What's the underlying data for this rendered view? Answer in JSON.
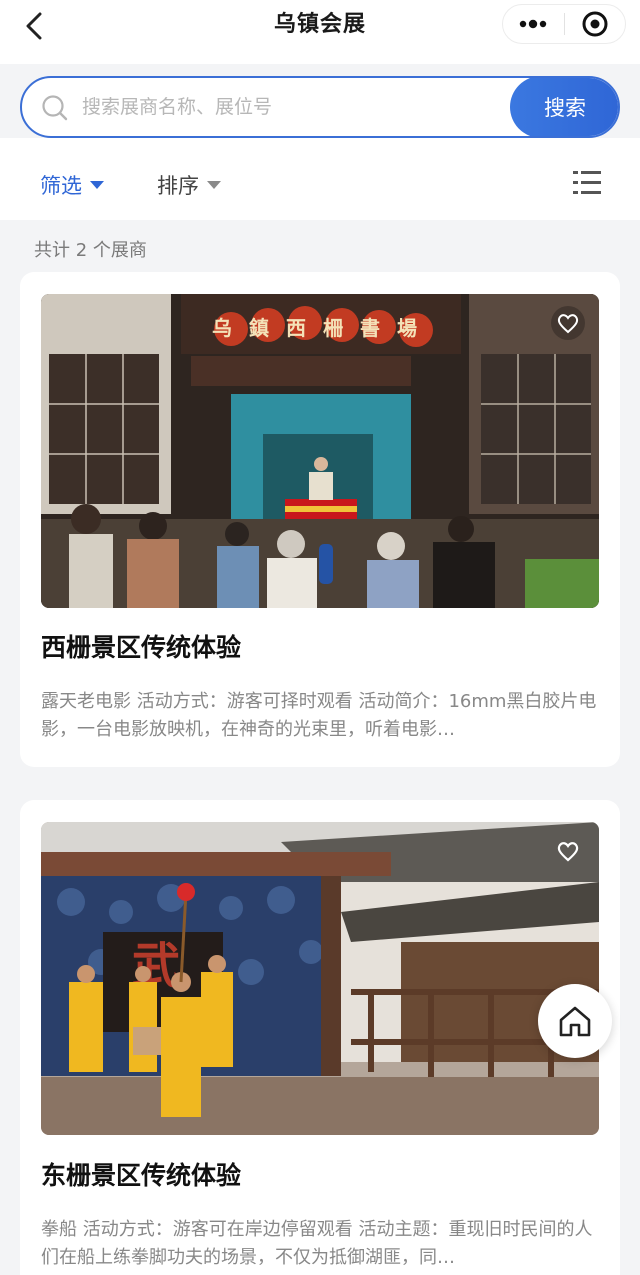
{
  "header": {
    "title": "乌镇会展",
    "back_icon": "chevron-left-icon",
    "more_icon": "more-dots-icon",
    "close_icon": "target-close-icon"
  },
  "search": {
    "placeholder": "搜索展商名称、展位号",
    "value": "",
    "button_label": "搜索"
  },
  "toolbar": {
    "filter_label": "筛选",
    "sort_label": "排序",
    "view_toggle_icon": "list-view-icon",
    "accent_color": "#2f66d6"
  },
  "results": {
    "count_text": "共计 2 个展商"
  },
  "items": [
    {
      "title": "西栅景区传统体验",
      "description": "露天老电影 活动方式：游客可择时观看 活动简介：16mm黑白胶片电影，一台电影放映机，在神奇的光束里，听着电影…",
      "image_sign": "乌鎮西柵書場",
      "favorite_icon": "heart-outline-icon"
    },
    {
      "title": "东栅景区传统体验",
      "description": "拳船 活动方式：游客可在岸边停留观看 活动主题：重现旧时民间的人们在船上练拳脚功夫的场景，不仅为抵御湖匪，同…",
      "image_sign": "武",
      "favorite_icon": "heart-outline-icon"
    }
  ],
  "fab": {
    "home_icon": "home-icon"
  }
}
